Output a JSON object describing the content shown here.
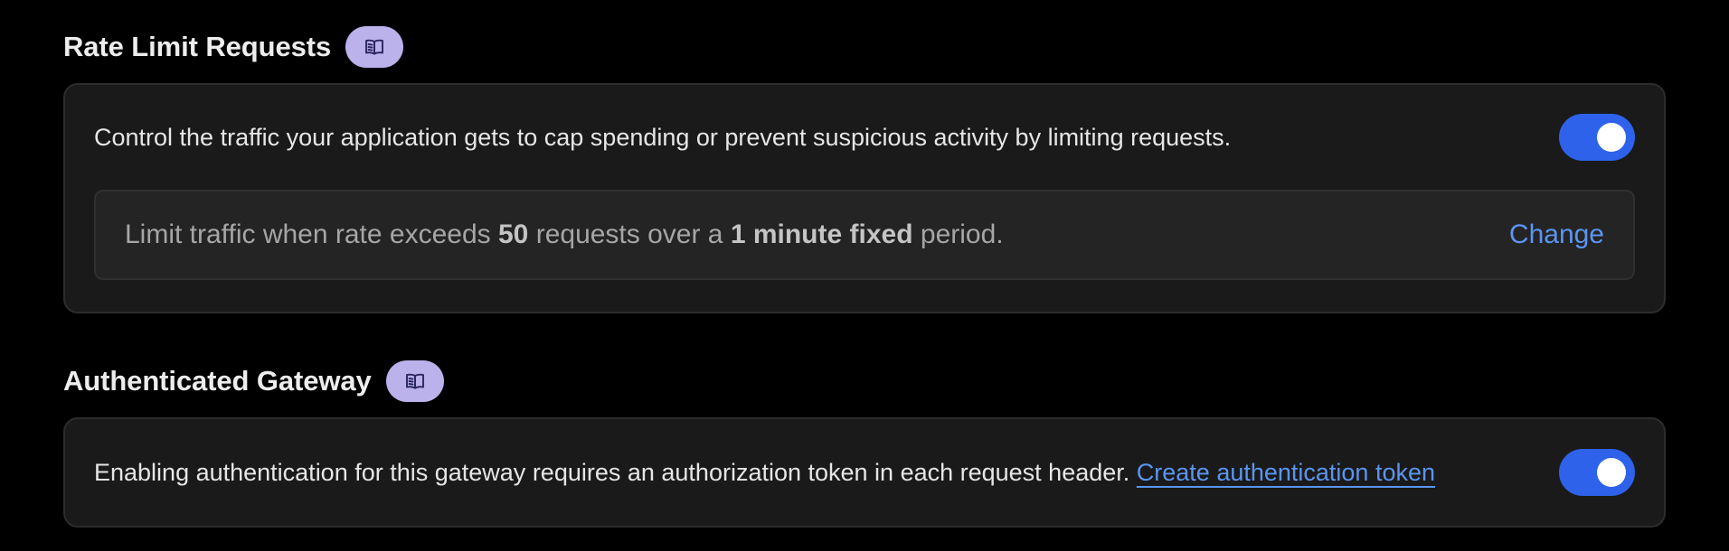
{
  "rate_limit": {
    "title": "Rate Limit Requests",
    "docs_icon": "book-icon",
    "description": "Control the traffic your application gets to cap spending or prevent suspicious activity by limiting requests.",
    "enabled": true,
    "rule": {
      "prefix": "Limit traffic when rate exceeds",
      "count": "50",
      "middle": "requests over a",
      "period": "1 minute fixed",
      "suffix": "period."
    },
    "change_label": "Change"
  },
  "auth_gateway": {
    "title": "Authenticated Gateway",
    "docs_icon": "book-icon",
    "description": "Enabling authentication for this gateway requires an authorization token in each request header.",
    "link_label": "Create authentication token",
    "enabled": true
  },
  "colors": {
    "toggle_on": "#2e62ea",
    "link": "#5b95f0",
    "badge": "#bbb2ec",
    "card_bg": "#1a1a1a"
  }
}
